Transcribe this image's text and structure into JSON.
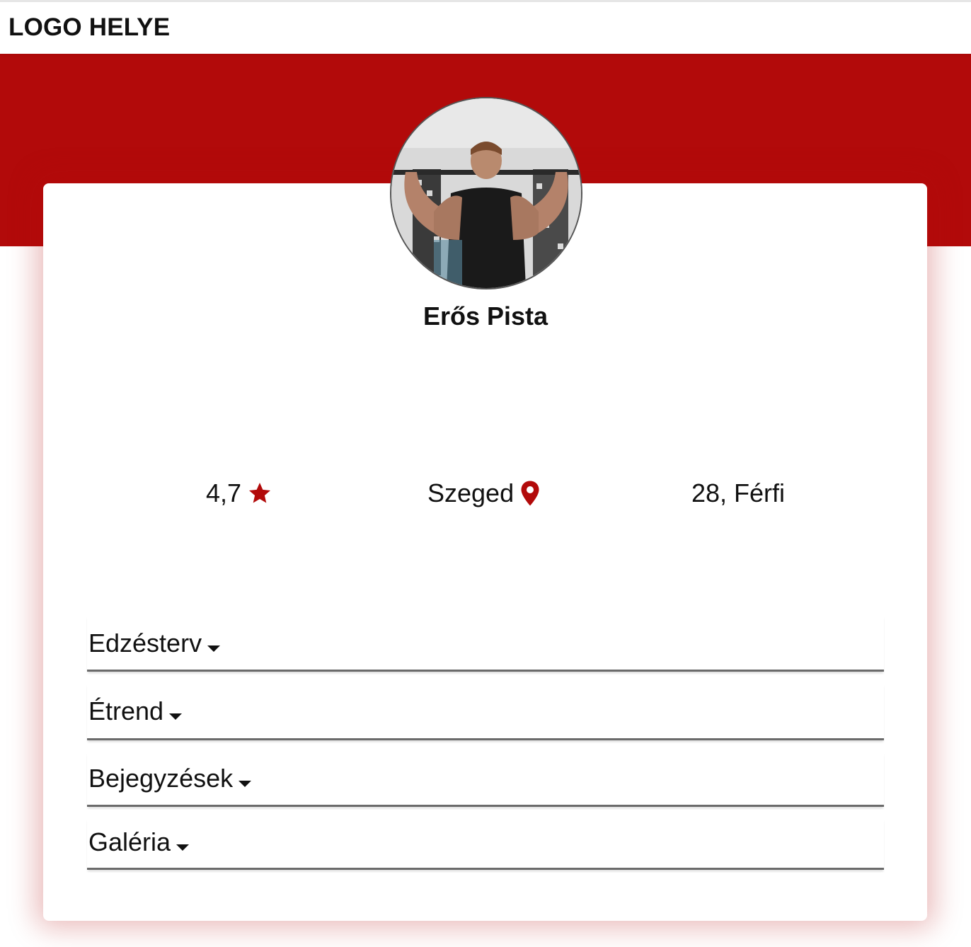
{
  "header": {
    "logo_text": "LOGO HELYE"
  },
  "colors": {
    "accent": "#b20a0a",
    "divider": "#6b6b6b"
  },
  "profile": {
    "name": "Erős Pista",
    "avatar_icon": "profile-photo",
    "rating": "4,7",
    "rating_icon": "star-icon",
    "location": "Szeged",
    "location_icon": "map-pin-icon",
    "age_gender": "28, Férfi"
  },
  "sections": [
    {
      "label": "Edzésterv",
      "icon": "caret-down-icon"
    },
    {
      "label": "Étrend",
      "icon": "caret-down-icon"
    },
    {
      "label": "Bejegyzések",
      "icon": "caret-down-icon"
    },
    {
      "label": "Galéria",
      "icon": "caret-down-icon"
    }
  ]
}
